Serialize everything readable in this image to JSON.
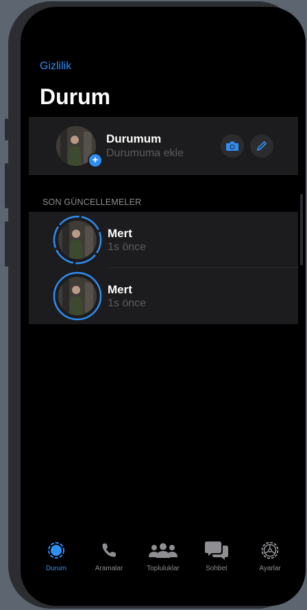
{
  "nav": {
    "privacy_link": "Gizlilik"
  },
  "header": {
    "title": "Durum"
  },
  "my_status": {
    "name": "Durumum",
    "subtitle": "Durumuma ekle",
    "actions": [
      {
        "icon": "camera-icon"
      },
      {
        "icon": "pencil-icon"
      }
    ]
  },
  "recent": {
    "section_title": "SON GÜNCELLEMELER",
    "items": [
      {
        "name": "Mert",
        "time": "1s önce",
        "ring": "dashed"
      },
      {
        "name": "Mert",
        "time": "1s önce",
        "ring": "solid"
      }
    ]
  },
  "tabbar": {
    "items": [
      {
        "label": "Durum",
        "icon": "status-icon",
        "active": true
      },
      {
        "label": "Aramalar",
        "icon": "phone-icon",
        "active": false
      },
      {
        "label": "Topluluklar",
        "icon": "communities-icon",
        "active": false
      },
      {
        "label": "Sohbet",
        "icon": "chats-icon",
        "active": false
      },
      {
        "label": "Ayarlar",
        "icon": "settings-icon",
        "active": false
      }
    ]
  },
  "colors": {
    "accent": "#2f8ef4",
    "background": "#000000",
    "card": "#1c1c1e"
  }
}
